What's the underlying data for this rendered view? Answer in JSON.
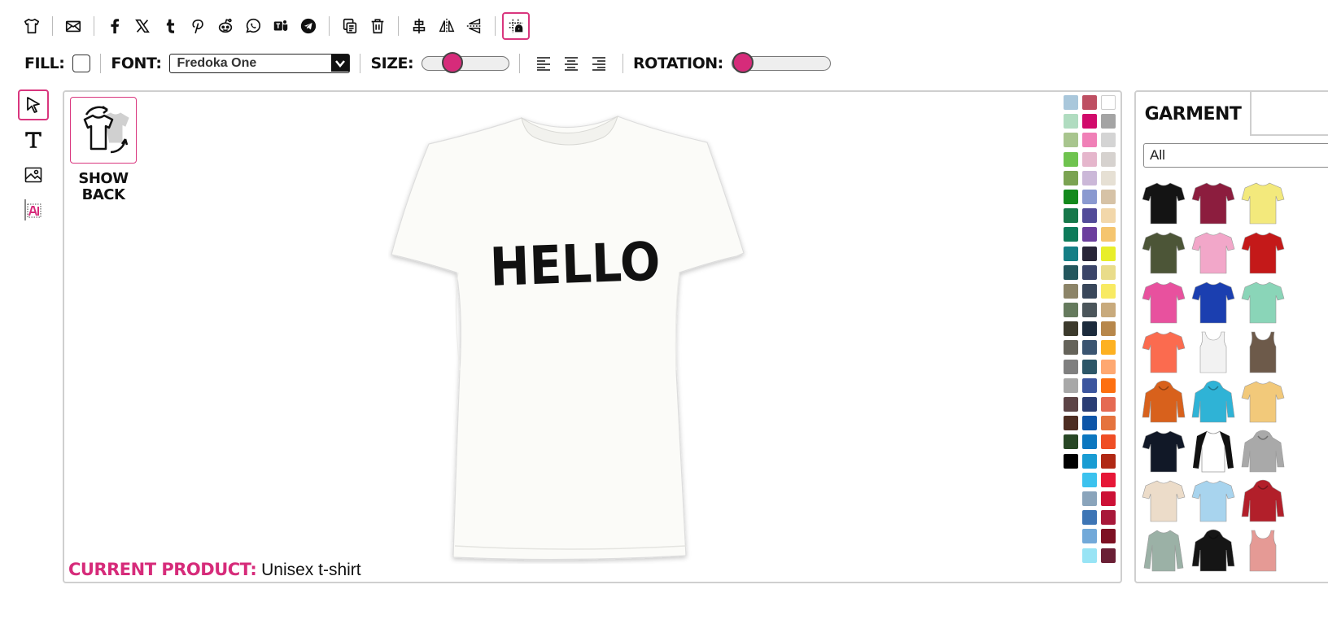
{
  "toolbar": {
    "items": [
      {
        "name": "product-icon",
        "label": "Product"
      },
      {
        "name": "email-icon",
        "label": "Email"
      },
      {
        "name": "facebook-icon",
        "label": "Facebook"
      },
      {
        "name": "x-icon",
        "label": "X"
      },
      {
        "name": "tumblr-icon",
        "label": "Tumblr"
      },
      {
        "name": "pinterest-icon",
        "label": "Pinterest"
      },
      {
        "name": "reddit-icon",
        "label": "Reddit"
      },
      {
        "name": "whatsapp-icon",
        "label": "WhatsApp"
      },
      {
        "name": "teams-icon",
        "label": "Teams"
      },
      {
        "name": "telegram-icon",
        "label": "Telegram"
      },
      {
        "name": "duplicate-icon",
        "label": "Duplicate"
      },
      {
        "name": "delete-icon",
        "label": "Delete"
      },
      {
        "name": "align-center-icon",
        "label": "Center"
      },
      {
        "name": "flip-horizontal-icon",
        "label": "Flip horizontal"
      },
      {
        "name": "flip-vertical-icon",
        "label": "Flip vertical"
      },
      {
        "name": "grid-icon",
        "label": "Grid"
      }
    ]
  },
  "options": {
    "fill_label": "FILL:",
    "font_label": "FONT:",
    "font_value": "Fredoka One",
    "size_label": "SIZE:",
    "size_value": 0.3,
    "rotation_label": "ROTATION:",
    "rotation_value": 0.0
  },
  "tools": [
    "select-tool-icon",
    "text-tool-icon",
    "image-tool-icon",
    "ai-tool-icon"
  ],
  "canvas": {
    "show_back_label_1": "SHOW",
    "show_back_label_2": "BACK",
    "design_text": "HELLO",
    "current_product_label": "CURRENT PRODUCT:",
    "current_product_value": "Unisex t-shirt",
    "shirt_color": "#ffffff"
  },
  "swatches": {
    "col1": [
      "#a9c7db",
      "#b0dcc0",
      "#a8c58e",
      "#6fc34f",
      "#7ba352",
      "#13891c",
      "#16784a",
      "#0d7b5a",
      "#147e85",
      "#23565d",
      "#8c8468",
      "#657a5d",
      "#3c3a2c",
      "#65635a",
      "#7f7f7f",
      "#a8a8a8",
      "#5c4446",
      "#4d2d22",
      "#284725",
      "#000000"
    ],
    "col2": [
      "#be4f62",
      "#d10b6b",
      "#f080b7",
      "#e5b6cc",
      "#cbb8d8",
      "#8a99d0",
      "#524b99",
      "#6b3e9d",
      "#282537",
      "#3a4468",
      "#39475a",
      "#4b555a",
      "#1c2b3c",
      "#3a5470",
      "#2c5668",
      "#3b559e",
      "#2a3d74",
      "#0d55a8",
      "#0b76bf",
      "#199cd3",
      "#3cc2ee",
      "#8aa4bb",
      "#3d75b5",
      "#72a9d9",
      "#98e4f5"
    ],
    "col3": [
      "#ffffff",
      "#a4a4a4",
      "#d4d4d4",
      "#d6d2cf",
      "#e6e0d4",
      "#d6c2a6",
      "#f2d7aa",
      "#f5c56e",
      "#e8ee2a",
      "#e9dc8a",
      "#f8ea63",
      "#c8aa7c",
      "#b7874b",
      "#fdb121",
      "#fea871",
      "#fd6f10",
      "#e56a53",
      "#e5733e",
      "#ef4e25",
      "#b02814",
      "#e61737",
      "#cc1136",
      "#a8183a",
      "#7d1023",
      "#6a1f35"
    ]
  },
  "garment_panel": {
    "tab_label": "GARMENT",
    "filter_value": "All",
    "items": [
      {
        "name": "black-tshirt-thumb",
        "color": "#141414",
        "type": "tee"
      },
      {
        "name": "maroon-tshirt-thumb",
        "color": "#8c1d3e",
        "type": "tee"
      },
      {
        "name": "yellow-tshirt-thumb",
        "color": "#f3e97c",
        "type": "tee"
      },
      {
        "name": "olive-tshirt-thumb",
        "color": "#4c5537",
        "type": "tee"
      },
      {
        "name": "pink-tshirt-thumb",
        "color": "#f2a7c9",
        "type": "tee"
      },
      {
        "name": "red-tshirt-thumb",
        "color": "#c41919",
        "type": "tee"
      },
      {
        "name": "magenta-tshirt-thumb",
        "color": "#e8519e",
        "type": "tee"
      },
      {
        "name": "royal-tshirt-thumb",
        "color": "#1b3fb0",
        "type": "tee"
      },
      {
        "name": "mint-tshirt-thumb",
        "color": "#8ad5b8",
        "type": "tee"
      },
      {
        "name": "coral-tshirt-thumb",
        "color": "#fb6b4f",
        "type": "tee"
      },
      {
        "name": "white-tank-thumb",
        "color": "#f2f2f2",
        "type": "tank"
      },
      {
        "name": "brown-tank-thumb",
        "color": "#6d5a4a",
        "type": "tank"
      },
      {
        "name": "orange-hoodie-thumb",
        "color": "#d8611c",
        "type": "hoodie"
      },
      {
        "name": "cyan-hoodie-thumb",
        "color": "#2fb3d6",
        "type": "hoodie"
      },
      {
        "name": "tiedye-tshirt-thumb",
        "color": "#f2c97a",
        "type": "tee"
      },
      {
        "name": "navy-tshirt-thumb",
        "color": "#111827",
        "type": "tee"
      },
      {
        "name": "raglan-thumb",
        "color": "#ffffff",
        "type": "raglan"
      },
      {
        "name": "grey-hoodie-thumb",
        "color": "#a9a9a9",
        "type": "hoodie"
      },
      {
        "name": "sand-tshirt-thumb",
        "color": "#ecdcc9",
        "type": "tee"
      },
      {
        "name": "ombre-tshirt-thumb",
        "color": "#a8d4ee",
        "type": "tee"
      },
      {
        "name": "varsity-jacket-thumb",
        "color": "#b21f2a",
        "type": "jacket"
      },
      {
        "name": "sage-longsleeve-thumb",
        "color": "#9bb1a6",
        "type": "longsleeve"
      },
      {
        "name": "black-orange-hoodie-thumb",
        "color": "#151515",
        "type": "hoodie"
      },
      {
        "name": "salmon-tank-thumb",
        "color": "#e59a95",
        "type": "tank"
      }
    ]
  }
}
